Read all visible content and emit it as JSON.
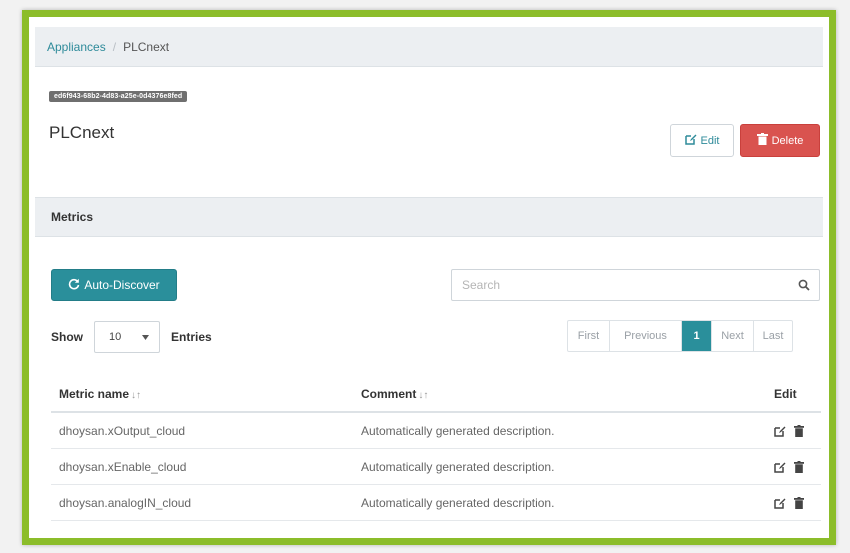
{
  "breadcrumb": {
    "root": "Appliances",
    "separator": "/",
    "current": "PLCnext"
  },
  "appliance": {
    "id": "ed6f943-68b2-4d83-a25e-0d4376e8fed",
    "title": "PLCnext"
  },
  "actions": {
    "edit_label": "Edit",
    "delete_label": "Delete"
  },
  "metrics": {
    "section_title": "Metrics",
    "discover_label": "Auto-Discover",
    "search_placeholder": "Search",
    "show_label": "Show",
    "entries_label": "Entries",
    "page_length": "10",
    "pagination": {
      "first": "First",
      "previous": "Previous",
      "current": "1",
      "next": "Next",
      "last": "Last"
    },
    "columns": {
      "name": "Metric name",
      "comment": "Comment",
      "edit": "Edit"
    },
    "rows": [
      {
        "name": "dhoysan.xOutput_cloud",
        "comment": "Automatically generated description."
      },
      {
        "name": "dhoysan.xEnable_cloud",
        "comment": "Automatically generated description."
      },
      {
        "name": "dhoysan.analogIN_cloud",
        "comment": "Automatically generated description."
      }
    ]
  },
  "colors": {
    "frame": "#8cbd2a",
    "accent": "#2a8f9b",
    "danger": "#d9534f"
  }
}
